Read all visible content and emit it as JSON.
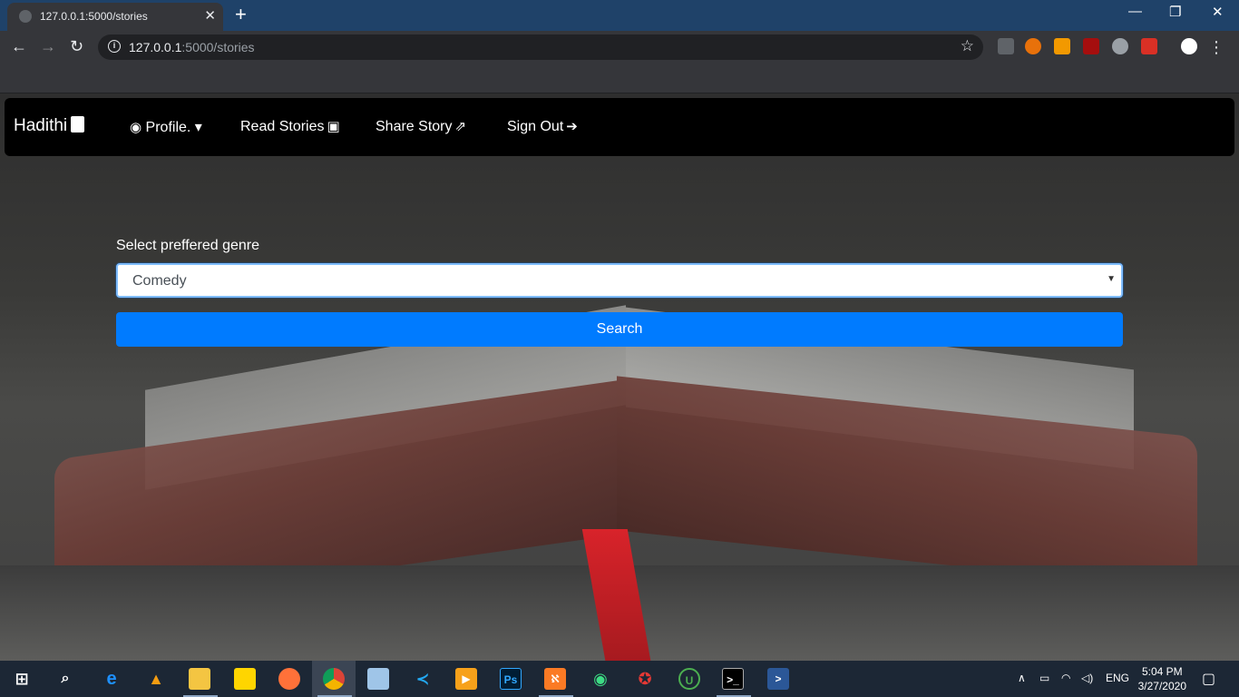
{
  "browser": {
    "tab_title": "127.0.0.1:5000/stories",
    "url_host": "127.0.0.1",
    "url_rest": ":5000/stories",
    "new_tab_symbol": "+",
    "close_symbol": "✕",
    "window_controls": [
      "—",
      "❐",
      "✕"
    ]
  },
  "navbar": {
    "brand": "Hadithi",
    "links": [
      {
        "label": "Profile.",
        "icon": "user-circle-icon"
      },
      {
        "label": "Read Stories",
        "icon": "book-reader-icon"
      },
      {
        "label": "Share Story",
        "icon": "share-square-icon"
      },
      {
        "label": "Sign Out",
        "icon": "sign-out-icon"
      }
    ]
  },
  "form": {
    "label": "Select preffered genre",
    "selected_genre": "Comedy",
    "search_label": "Search"
  },
  "taskbar": {
    "language": "ENG",
    "time": "5:04 PM",
    "date": "3/27/2020"
  },
  "colors": {
    "primary": "#007bff",
    "navbar_bg": "#000000",
    "tabbar_bg": "#1f4269",
    "taskbar_bg": "#1c2735"
  }
}
